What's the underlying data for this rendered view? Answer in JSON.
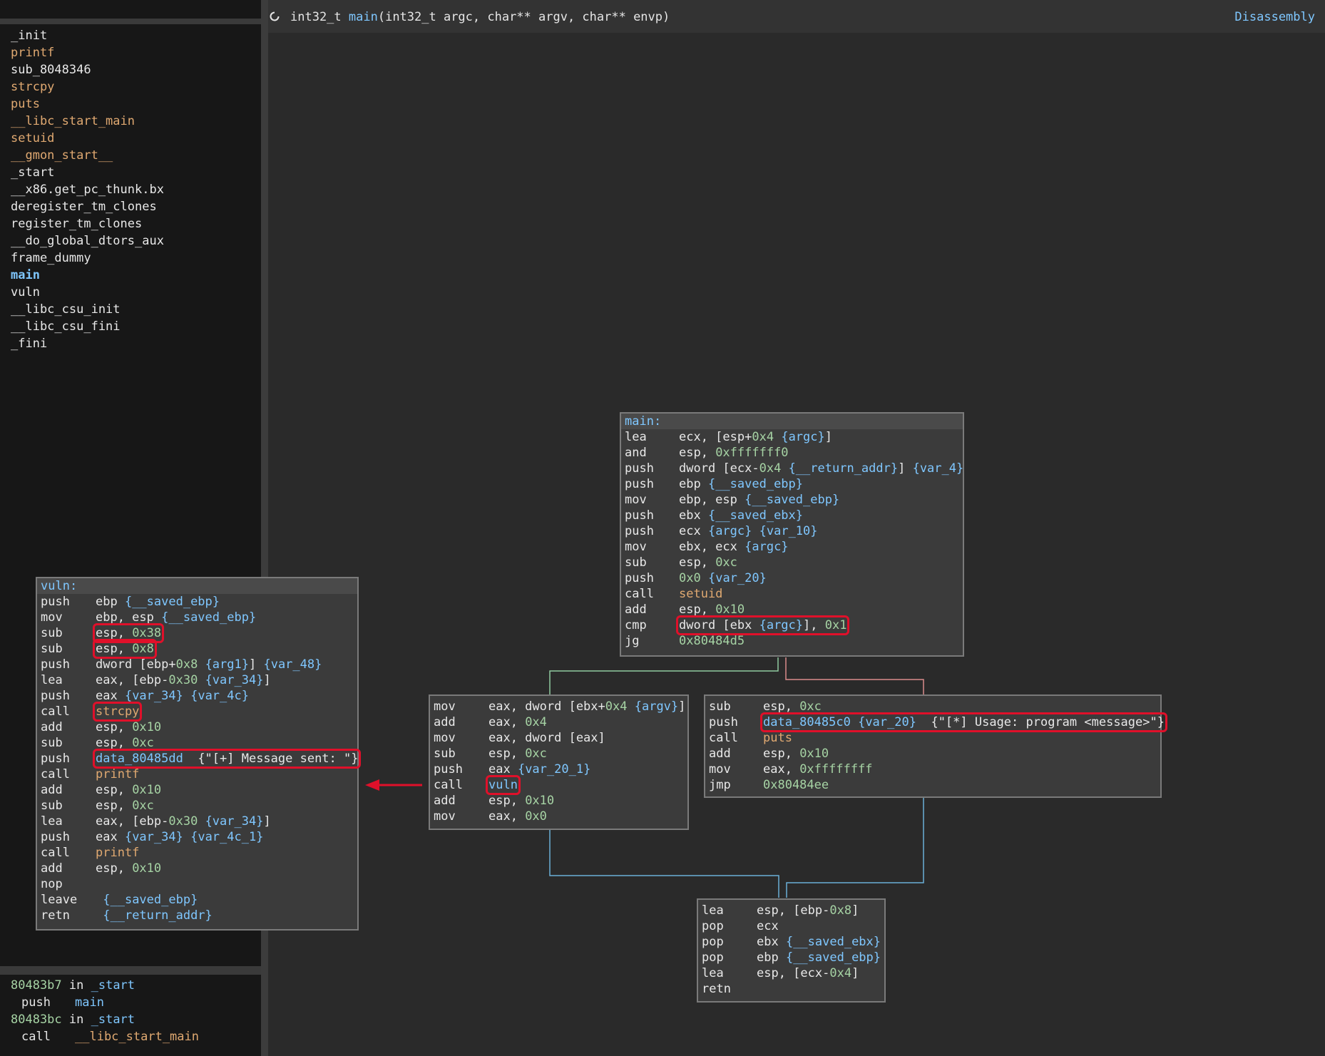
{
  "sidebar": {
    "functions": [
      {
        "name": "_init",
        "color": "white"
      },
      {
        "name": "printf",
        "color": "orange"
      },
      {
        "name": "sub_8048346",
        "color": "white"
      },
      {
        "name": "strcpy",
        "color": "orange"
      },
      {
        "name": "puts",
        "color": "orange"
      },
      {
        "name": "__libc_start_main",
        "color": "orange"
      },
      {
        "name": "setuid",
        "color": "orange"
      },
      {
        "name": "__gmon_start__",
        "color": "orange"
      },
      {
        "name": "_start",
        "color": "white"
      },
      {
        "name": "__x86.get_pc_thunk.bx",
        "color": "white"
      },
      {
        "name": "deregister_tm_clones",
        "color": "white"
      },
      {
        "name": "register_tm_clones",
        "color": "white"
      },
      {
        "name": "__do_global_dtors_aux",
        "color": "white"
      },
      {
        "name": "frame_dummy",
        "color": "white"
      },
      {
        "name": "main",
        "color": "blue"
      },
      {
        "name": "vuln",
        "color": "white"
      },
      {
        "name": "__libc_csu_init",
        "color": "white"
      },
      {
        "name": "__libc_csu_fini",
        "color": "white"
      },
      {
        "name": "_fini",
        "color": "white"
      }
    ],
    "xrefs": [
      {
        "addr": "80483b7",
        "in": " in ",
        "func": "_start",
        "op": "push",
        "target": "main",
        "target_color": "blue"
      },
      {
        "addr": "80483bc",
        "in": " in ",
        "func": "_start",
        "op": "call",
        "target": "__libc_start_main",
        "target_color": "orange"
      }
    ]
  },
  "header": {
    "signature_ret": "int32_t ",
    "signature_name": "main",
    "signature_args": "(int32_t argc, char** argv, char** envp)",
    "view_label": "Disassembly",
    "refresh_icon": "refresh-icon"
  },
  "colors": {
    "highlight": "#e0102a",
    "edge_green": "#8fc9a0",
    "edge_red": "#d98b8b",
    "edge_blue": "#6ab0d8",
    "arrow_red": "#e0102a"
  },
  "blocks": {
    "main": {
      "label": "main:",
      "lines": [
        {
          "mn": "lea",
          "ops": [
            [
              "plain",
              "ecx, [esp+"
            ],
            [
              "num",
              "0x4"
            ],
            [
              "plain",
              " "
            ],
            [
              "var",
              "{argc}"
            ],
            [
              "plain",
              "]"
            ]
          ]
        },
        {
          "mn": "and",
          "ops": [
            [
              "plain",
              "esp, "
            ],
            [
              "num",
              "0xfffffff0"
            ]
          ]
        },
        {
          "mn": "push",
          "ops": [
            [
              "plain",
              "dword [ecx-"
            ],
            [
              "num",
              "0x4"
            ],
            [
              "plain",
              " "
            ],
            [
              "var",
              "{__return_addr}"
            ],
            [
              "plain",
              "] "
            ],
            [
              "var",
              "{var_4}"
            ]
          ]
        },
        {
          "mn": "push",
          "ops": [
            [
              "plain",
              "ebp "
            ],
            [
              "var",
              "{__saved_ebp}"
            ]
          ]
        },
        {
          "mn": "mov",
          "ops": [
            [
              "plain",
              "ebp, esp "
            ],
            [
              "var",
              "{__saved_ebp}"
            ]
          ]
        },
        {
          "mn": "push",
          "ops": [
            [
              "plain",
              "ebx "
            ],
            [
              "var",
              "{__saved_ebx}"
            ]
          ]
        },
        {
          "mn": "push",
          "ops": [
            [
              "plain",
              "ecx "
            ],
            [
              "var",
              "{argc}"
            ],
            [
              "plain",
              " "
            ],
            [
              "var",
              "{var_10}"
            ]
          ]
        },
        {
          "mn": "mov",
          "ops": [
            [
              "plain",
              "ebx, ecx "
            ],
            [
              "var",
              "{argc}"
            ]
          ]
        },
        {
          "mn": "sub",
          "ops": [
            [
              "plain",
              "esp, "
            ],
            [
              "num",
              "0xc"
            ]
          ]
        },
        {
          "mn": "push",
          "ops": [
            [
              "num",
              "0x0"
            ],
            [
              "plain",
              " "
            ],
            [
              "var",
              "{var_20}"
            ]
          ]
        },
        {
          "mn": "call",
          "ops": [
            [
              "sym",
              "setuid"
            ]
          ]
        },
        {
          "mn": "add",
          "ops": [
            [
              "plain",
              "esp, "
            ],
            [
              "num",
              "0x10"
            ]
          ]
        },
        {
          "mn": "cmp",
          "hl": true,
          "ops": [
            [
              "plain",
              "dword [ebx "
            ],
            [
              "var",
              "{argc}"
            ],
            [
              "plain",
              "], "
            ],
            [
              "num",
              "0x1"
            ]
          ]
        },
        {
          "mn": "jg",
          "ops": [
            [
              "num",
              "0x80484d5"
            ]
          ]
        }
      ]
    },
    "left": {
      "lines": [
        {
          "mn": "mov",
          "ops": [
            [
              "plain",
              "eax, dword [ebx+"
            ],
            [
              "num",
              "0x4"
            ],
            [
              "plain",
              " "
            ],
            [
              "var",
              "{argv}"
            ],
            [
              "plain",
              "]"
            ]
          ]
        },
        {
          "mn": "add",
          "ops": [
            [
              "plain",
              "eax, "
            ],
            [
              "num",
              "0x4"
            ]
          ]
        },
        {
          "mn": "mov",
          "ops": [
            [
              "plain",
              "eax, dword [eax]"
            ]
          ]
        },
        {
          "mn": "sub",
          "ops": [
            [
              "plain",
              "esp, "
            ],
            [
              "num",
              "0xc"
            ]
          ]
        },
        {
          "mn": "push",
          "ops": [
            [
              "plain",
              "eax "
            ],
            [
              "var",
              "{var_20_1}"
            ]
          ]
        },
        {
          "mn": "call",
          "hl": true,
          "ops": [
            [
              "var",
              "vuln"
            ]
          ]
        },
        {
          "mn": "add",
          "ops": [
            [
              "plain",
              "esp, "
            ],
            [
              "num",
              "0x10"
            ]
          ]
        },
        {
          "mn": "mov",
          "ops": [
            [
              "plain",
              "eax, "
            ],
            [
              "num",
              "0x0"
            ]
          ]
        }
      ]
    },
    "right": {
      "lines": [
        {
          "mn": "sub",
          "ops": [
            [
              "plain",
              "esp, "
            ],
            [
              "num",
              "0xc"
            ]
          ]
        },
        {
          "mn": "push",
          "hl": true,
          "ops": [
            [
              "data",
              "data_80485c0"
            ],
            [
              "plain",
              " "
            ],
            [
              "var",
              "{var_20}"
            ],
            [
              "plain",
              "  "
            ],
            [
              "str",
              "{\"[*] Usage: program <message>\"}"
            ]
          ]
        },
        {
          "mn": "call",
          "ops": [
            [
              "sym",
              "puts"
            ]
          ]
        },
        {
          "mn": "add",
          "ops": [
            [
              "plain",
              "esp, "
            ],
            [
              "num",
              "0x10"
            ]
          ]
        },
        {
          "mn": "mov",
          "ops": [
            [
              "plain",
              "eax, "
            ],
            [
              "num",
              "0xffffffff"
            ]
          ]
        },
        {
          "mn": "jmp",
          "ops": [
            [
              "num",
              "0x80484ee"
            ]
          ]
        }
      ]
    },
    "bottom": {
      "lines": [
        {
          "mn": "lea",
          "ops": [
            [
              "plain",
              "esp, [ebp-"
            ],
            [
              "num",
              "0x8"
            ],
            [
              "plain",
              "]"
            ]
          ]
        },
        {
          "mn": "pop",
          "ops": [
            [
              "plain",
              "ecx"
            ]
          ]
        },
        {
          "mn": "pop",
          "ops": [
            [
              "plain",
              "ebx "
            ],
            [
              "var",
              "{__saved_ebx}"
            ]
          ]
        },
        {
          "mn": "pop",
          "ops": [
            [
              "plain",
              "ebp "
            ],
            [
              "var",
              "{__saved_ebp}"
            ]
          ]
        },
        {
          "mn": "lea",
          "ops": [
            [
              "plain",
              "esp, [ecx-"
            ],
            [
              "num",
              "0x4"
            ],
            [
              "plain",
              "]"
            ]
          ]
        },
        {
          "mn": "retn",
          "ops": []
        }
      ]
    },
    "vuln": {
      "label": "vuln:",
      "lines": [
        {
          "mn": "push",
          "ops": [
            [
              "plain",
              "ebp "
            ],
            [
              "var",
              "{__saved_ebp}"
            ]
          ]
        },
        {
          "mn": "mov",
          "ops": [
            [
              "plain",
              "ebp, esp "
            ],
            [
              "var",
              "{__saved_ebp}"
            ]
          ]
        },
        {
          "mn": "sub",
          "hl": true,
          "ops": [
            [
              "plain",
              "esp, "
            ],
            [
              "num",
              "0x38"
            ]
          ]
        },
        {
          "mn": "sub",
          "hl": true,
          "ops": [
            [
              "plain",
              "esp, "
            ],
            [
              "num",
              "0x8"
            ]
          ]
        },
        {
          "mn": "push",
          "ops": [
            [
              "plain",
              "dword [ebp+"
            ],
            [
              "num",
              "0x8"
            ],
            [
              "plain",
              " "
            ],
            [
              "var",
              "{arg1}"
            ],
            [
              "plain",
              "] "
            ],
            [
              "var",
              "{var_48}"
            ]
          ]
        },
        {
          "mn": "lea",
          "ops": [
            [
              "plain",
              "eax, [ebp-"
            ],
            [
              "num",
              "0x30"
            ],
            [
              "plain",
              " "
            ],
            [
              "var",
              "{var_34}"
            ],
            [
              "plain",
              "]"
            ]
          ]
        },
        {
          "mn": "push",
          "ops": [
            [
              "plain",
              "eax "
            ],
            [
              "var",
              "{var_34}"
            ],
            [
              "plain",
              " "
            ],
            [
              "var",
              "{var_4c}"
            ]
          ]
        },
        {
          "mn": "call",
          "hl": true,
          "ops": [
            [
              "sym",
              "strcpy"
            ]
          ]
        },
        {
          "mn": "add",
          "ops": [
            [
              "plain",
              "esp, "
            ],
            [
              "num",
              "0x10"
            ]
          ]
        },
        {
          "mn": "sub",
          "ops": [
            [
              "plain",
              "esp, "
            ],
            [
              "num",
              "0xc"
            ]
          ]
        },
        {
          "mn": "push",
          "hl": true,
          "ops": [
            [
              "data",
              "data_80485dd"
            ],
            [
              "plain",
              "  "
            ],
            [
              "str",
              "{\"[+] Message sent: \"}"
            ]
          ]
        },
        {
          "mn": "call",
          "ops": [
            [
              "sym",
              "printf"
            ]
          ]
        },
        {
          "mn": "add",
          "ops": [
            [
              "plain",
              "esp, "
            ],
            [
              "num",
              "0x10"
            ]
          ]
        },
        {
          "mn": "sub",
          "ops": [
            [
              "plain",
              "esp, "
            ],
            [
              "num",
              "0xc"
            ]
          ]
        },
        {
          "mn": "lea",
          "ops": [
            [
              "plain",
              "eax, [ebp-"
            ],
            [
              "num",
              "0x30"
            ],
            [
              "plain",
              " "
            ],
            [
              "var",
              "{var_34}"
            ],
            [
              "plain",
              "]"
            ]
          ]
        },
        {
          "mn": "push",
          "ops": [
            [
              "plain",
              "eax "
            ],
            [
              "var",
              "{var_34}"
            ],
            [
              "plain",
              " "
            ],
            [
              "var",
              "{var_4c_1}"
            ]
          ]
        },
        {
          "mn": "call",
          "ops": [
            [
              "sym",
              "printf"
            ]
          ]
        },
        {
          "mn": "add",
          "ops": [
            [
              "plain",
              "esp, "
            ],
            [
              "num",
              "0x10"
            ]
          ]
        },
        {
          "mn": "nop",
          "ops": []
        },
        {
          "mn": "leave",
          "ops": [
            [
              "plain",
              " "
            ],
            [
              "var",
              "{__saved_ebp}"
            ]
          ]
        },
        {
          "mn": "retn",
          "ops": [
            [
              "plain",
              " "
            ],
            [
              "var",
              "{__return_addr}"
            ]
          ]
        }
      ]
    }
  }
}
